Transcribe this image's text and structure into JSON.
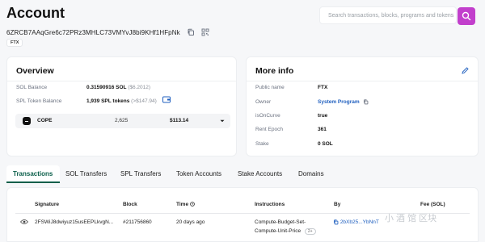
{
  "page": {
    "title": "Account"
  },
  "search": {
    "placeholder": "Search transactions, blocks, programs and tokens"
  },
  "account": {
    "address": "6ZRCB7AAqGre6c72PRz3MHLC73VMYvJ8bi9KHf1HFpNk",
    "label": "FTX"
  },
  "overview": {
    "title": "Overview",
    "sol_balance_label": "SOL Balance",
    "sol_balance_value": "0.31590916 SOL",
    "sol_balance_usd": "($6.2012)",
    "spl_label": "SPL Token Balance",
    "spl_value": "1,939 SPL tokens",
    "spl_usd": "(>$147.94)",
    "selected_token": {
      "symbol": "COPE",
      "amount": "2,625",
      "usd": "$113.14"
    }
  },
  "more_info": {
    "title": "More info",
    "rows": [
      {
        "label": "Public name",
        "value": "FTX"
      },
      {
        "label": "Owner",
        "value": "System Program"
      },
      {
        "label": "isOnCurve",
        "value": "true"
      },
      {
        "label": "Rent Epoch",
        "value": "361"
      },
      {
        "label": "Stake",
        "value": "0 SOL"
      }
    ]
  },
  "tabs": [
    "Transactions",
    "SOL Transfers",
    "SPL Transfers",
    "Token Accounts",
    "Stake Accounts",
    "Domains"
  ],
  "tx_table": {
    "headers": {
      "signature": "Signature",
      "block": "Block",
      "time": "Time",
      "instructions": "Instructions",
      "by": "By",
      "fee": "Fee (SOL)"
    },
    "rows": [
      {
        "signature": "2FSWiJ8dwiyuz15usEEPLkvgN...",
        "block": "#211756860",
        "time": "20 days ago",
        "instructions_line1": "Compute-Budget-Set-",
        "instructions_line2": "Compute-Unit-Price",
        "instructions_more": "2+",
        "by": "2bXb25...YbNnT"
      }
    ]
  },
  "watermark": "小 酒 馆 区块",
  "colors": {
    "accent": "#c23fcc",
    "active_tab": "#0b5f4a",
    "link": "#1f5fbf"
  }
}
